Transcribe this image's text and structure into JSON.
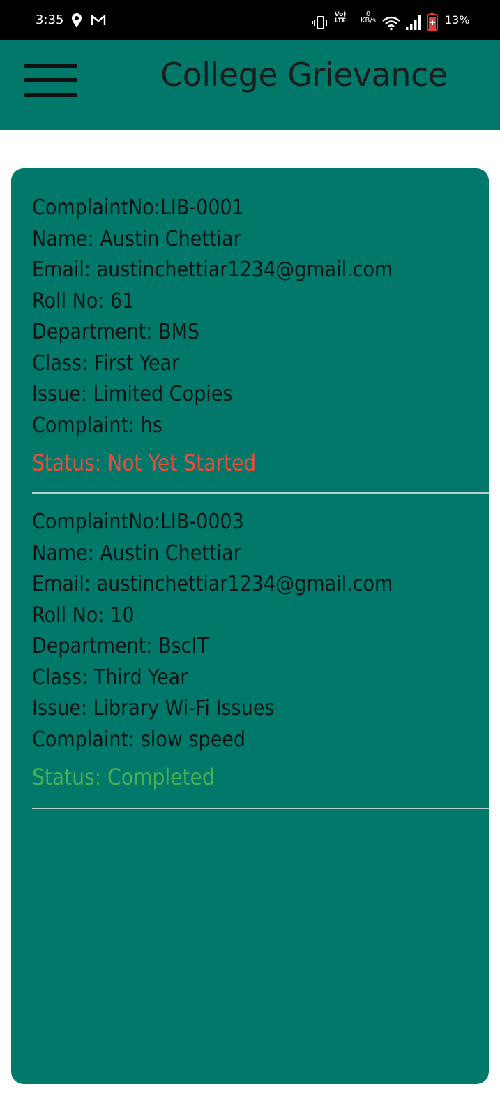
{
  "status_bar": {
    "time": "3:35",
    "network_label_top": "Vo)",
    "network_label_bottom": "LTE",
    "speed_value": "0",
    "speed_unit": "KB/s",
    "battery": "13%",
    "icons": [
      "location-icon",
      "gmail-icon",
      "vibrate-icon",
      "wifi-icon",
      "signal-icon",
      "battery-icon"
    ]
  },
  "app_bar": {
    "title": "College Grievance",
    "background": "#00796b",
    "menu_icon": "hamburger-menu-icon"
  },
  "complaints": [
    {
      "complaint_no": "ComplaintNo:LIB-0001",
      "name": "Name: Austin Chettiar",
      "email": "Email: austinchettiar1234@gmail.com",
      "roll_no": "Roll No: 61",
      "department": "Department: BMS",
      "class": "Class: First Year",
      "issue": "Issue: Limited Copies",
      "complaint": "Complaint: hs",
      "status": "Status: Not Yet Started",
      "status_color": "#f04b3a"
    },
    {
      "complaint_no": "ComplaintNo:LIB-0003",
      "name": "Name: Austin Chettiar",
      "email": "Email: austinchettiar1234@gmail.com",
      "roll_no": "Roll No: 10",
      "department": "Department: BscIT",
      "class": "Class: Third Year",
      "issue": "Issue: Library Wi-Fi Issues",
      "complaint": "Complaint: slow speed",
      "status": "Status: Completed",
      "status_color": "#4caf50"
    }
  ]
}
